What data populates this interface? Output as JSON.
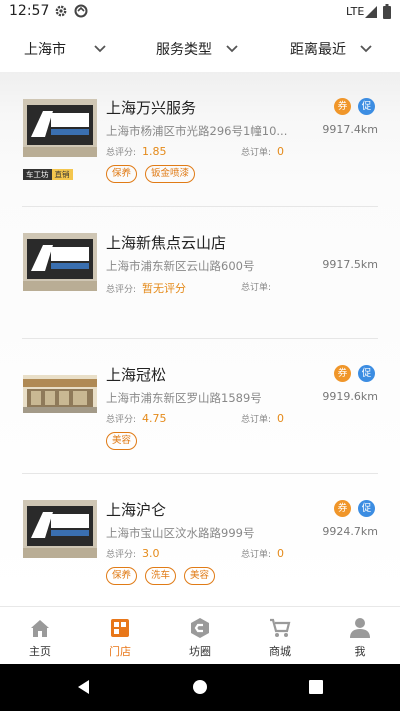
{
  "status": {
    "time": "12:57",
    "network": "LTE",
    "icons": [
      "gear-icon",
      "sync-icon",
      "signal-icon",
      "battery-icon"
    ]
  },
  "filters": [
    {
      "label": "上海市"
    },
    {
      "label": "服务类型"
    },
    {
      "label": "距离最近"
    }
  ],
  "labels": {
    "score": "总评分:",
    "orders": "总订单:",
    "coupon": "券",
    "promo": "促"
  },
  "shops": [
    {
      "name": "上海万兴服务",
      "address": "上海市杨浦区市光路296号1幢10...",
      "distance": "9917.4km",
      "score": "1.85",
      "orders": "0",
      "tags": [
        "保养",
        "钣金喷漆"
      ],
      "coupon": true,
      "promo": true,
      "brand": [
        "车工坊",
        "直销"
      ]
    },
    {
      "name": "上海新焦点云山店",
      "address": "上海市浦东新区云山路600号",
      "distance": "9917.5km",
      "score": "暂无评分",
      "orders": "",
      "tags": [],
      "coupon": false,
      "promo": false
    },
    {
      "name": "上海冠松",
      "address": "上海市浦东新区罗山路1589号",
      "distance": "9919.6km",
      "score": "4.75",
      "orders": "0",
      "tags": [
        "美容"
      ],
      "coupon": true,
      "promo": true
    },
    {
      "name": "上海沪仑",
      "address": "上海市宝山区汶水路路999号",
      "distance": "9924.7km",
      "score": "3.0",
      "orders": "0",
      "tags": [
        "保养",
        "洗车",
        "美容"
      ],
      "coupon": true,
      "promo": true
    }
  ],
  "tabs": [
    {
      "label": "主页",
      "icon": "home-icon",
      "active": false
    },
    {
      "label": "门店",
      "icon": "store-icon",
      "active": true
    },
    {
      "label": "坊圈",
      "icon": "circle-community-icon",
      "active": false
    },
    {
      "label": "商城",
      "icon": "cart-icon",
      "active": false
    },
    {
      "label": "我",
      "icon": "profile-icon",
      "active": false
    }
  ],
  "colors": {
    "accent": "#e8771a",
    "coupon": "#f0962a",
    "promo": "#3c8de2"
  }
}
